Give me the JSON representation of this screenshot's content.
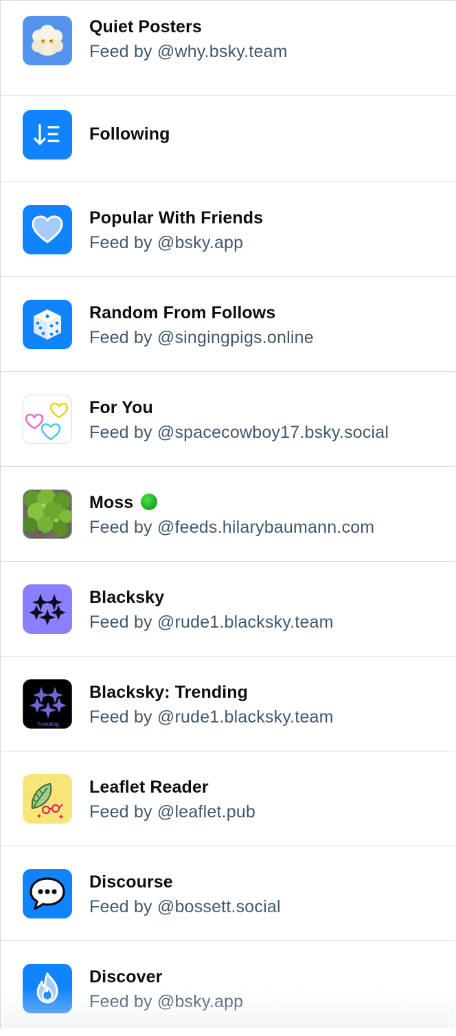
{
  "feeds": [
    {
      "title": "Quiet Posters",
      "subtitle": "Feed by @why.bsky.team",
      "icon": "cloud-face-icon"
    },
    {
      "title": "Following",
      "subtitle": "",
      "icon": "sort-list-icon"
    },
    {
      "title": "Popular With Friends",
      "subtitle": "Feed by @bsky.app",
      "icon": "heart-icon"
    },
    {
      "title": "Random From Follows",
      "subtitle": "Feed by @singingpigs.online",
      "icon": "dice-icon"
    },
    {
      "title": "For You",
      "subtitle": "Feed by @spacecowboy17.bsky.social",
      "icon": "three-hearts-icon"
    },
    {
      "title": "Moss",
      "badge": "🟢",
      "subtitle": "Feed by @feeds.hilarybaumann.com",
      "icon": "moss-photo-icon"
    },
    {
      "title": "Blacksky",
      "subtitle": "Feed by @rude1.blacksky.team",
      "icon": "sparkle-stars-icon"
    },
    {
      "title": "Blacksky: Trending",
      "subtitle": "Feed by @rude1.blacksky.team",
      "icon": "sparkle-stars-trending-icon",
      "icon_text": "Trending"
    },
    {
      "title": "Leaflet Reader",
      "subtitle": "Feed by @leaflet.pub",
      "icon": "leaf-glasses-icon"
    },
    {
      "title": "Discourse",
      "subtitle": "Feed by @bossett.social",
      "icon": "speech-bubble-icon"
    },
    {
      "title": "Discover",
      "subtitle": "Feed by @bsky.app",
      "icon": "flame-icon"
    }
  ],
  "colors": {
    "accent": "#1083fe",
    "title": "#0b0f14",
    "subtitle": "#42576c",
    "divider": "#d4dbe2"
  }
}
